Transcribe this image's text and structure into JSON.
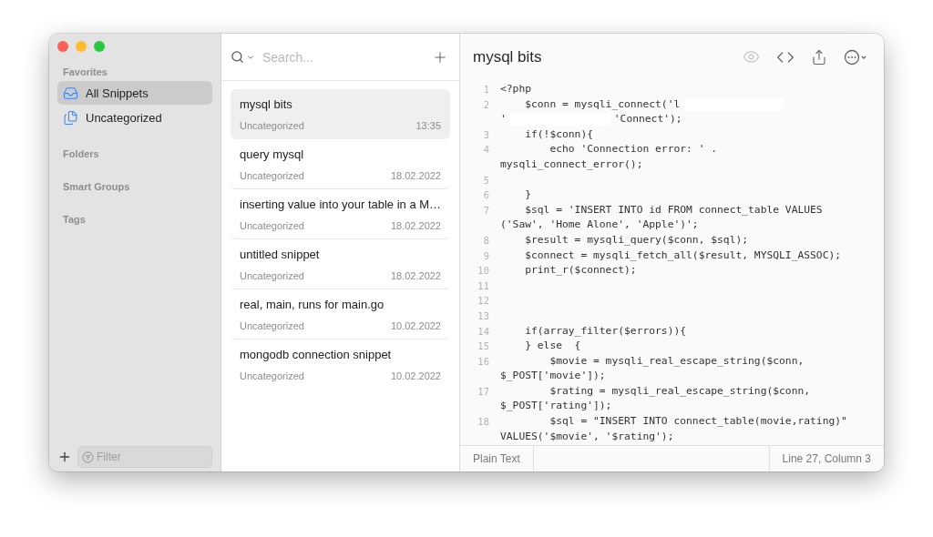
{
  "sidebar": {
    "sections": [
      {
        "title": "Favorites",
        "items": [
          {
            "label": "All Snippets",
            "kind": "all",
            "selected": true
          },
          {
            "label": "Uncategorized",
            "kind": "uncategorized",
            "selected": false
          }
        ]
      },
      {
        "title": "Folders"
      },
      {
        "title": "Smart Groups"
      },
      {
        "title": "Tags"
      }
    ],
    "filter": {
      "placeholder": "Filter"
    }
  },
  "list": {
    "search": {
      "placeholder": "Search..."
    },
    "snippets": [
      {
        "title": "mysql bits",
        "category": "Uncategorized",
        "date": "13:35",
        "selected": true
      },
      {
        "title": "query mysql",
        "category": "Uncategorized",
        "date": "18.02.2022",
        "selected": false
      },
      {
        "title": "inserting value into your table in a M…",
        "category": "Uncategorized",
        "date": "18.02.2022",
        "selected": false
      },
      {
        "title": "untitled snippet",
        "category": "Uncategorized",
        "date": "18.02.2022",
        "selected": false
      },
      {
        "title": "real, main, runs for main.go",
        "category": "Uncategorized",
        "date": "10.02.2022",
        "selected": false
      },
      {
        "title": "mongodb connection snippet",
        "category": "Uncategorized",
        "date": "10.02.2022",
        "selected": false
      }
    ]
  },
  "editor": {
    "title": "mysql bits",
    "lines": [
      {
        "number": "1",
        "rows": [
          {
            "text": "<?php"
          }
        ]
      },
      {
        "number": "2",
        "rows": [
          {
            "text": "    $conn = mysqli_connect('l",
            "redacted": true
          },
          {
            "text": "'",
            "redacted": true,
            "tail": "'Connect');"
          }
        ]
      },
      {
        "number": "3",
        "rows": [
          {
            "text": "    if(!$conn){"
          }
        ]
      },
      {
        "number": "4",
        "rows": [
          {
            "text": "        echo 'Connection error: ' ."
          },
          {
            "text": "mysqli_connect_error();"
          }
        ]
      },
      {
        "number": "5"
      },
      {
        "number": "6",
        "rows": [
          {
            "text": "    }"
          }
        ]
      },
      {
        "number": "7",
        "rows": [
          {
            "text": "    $sql = 'INSERT INTO id FROM connect_table VALUES"
          },
          {
            "text": "('Saw', 'Home Alone', 'Apple')';"
          }
        ]
      },
      {
        "number": "8",
        "rows": [
          {
            "text": "    $result = mysqli_query($conn, $sql);"
          }
        ]
      },
      {
        "number": "9",
        "rows": [
          {
            "text": "    $connect = mysqli_fetch_all($result, MYSQLI_ASSOC);"
          }
        ]
      },
      {
        "number": "10",
        "rows": [
          {
            "text": "    print_r($connect);"
          }
        ]
      },
      {
        "number": "11"
      },
      {
        "number": "12"
      },
      {
        "number": "13"
      },
      {
        "number": "14",
        "rows": [
          {
            "text": "    if(array_filter($errors)){"
          }
        ]
      },
      {
        "number": "15",
        "rows": [
          {
            "text": "    } else  {"
          }
        ]
      },
      {
        "number": "16",
        "rows": [
          {
            "text": "        $movie = mysqli_real_escape_string($conn,"
          },
          {
            "text": "$_POST['movie']);"
          }
        ]
      },
      {
        "number": "17",
        "rows": [
          {
            "text": "        $rating = mysqli_real_escape_string($conn,"
          },
          {
            "text": "$_POST['rating']);"
          }
        ]
      },
      {
        "number": "18",
        "rows": [
          {
            "text": "        $sql = \"INSERT INTO connect_table(movie,rating)\""
          },
          {
            "text": "VALUES('$movie', '$rating');"
          }
        ]
      }
    ],
    "status": {
      "language": "Plain Text",
      "position": "Line 27, Column 3"
    }
  }
}
